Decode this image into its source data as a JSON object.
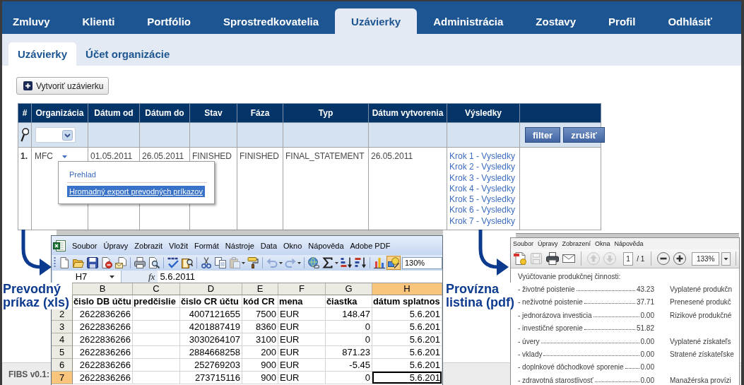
{
  "main_nav": {
    "tabs": [
      {
        "label": "Zmluvy",
        "selected": false
      },
      {
        "label": "Klienti",
        "selected": false
      },
      {
        "label": "Portfólio",
        "selected": false
      },
      {
        "label": "Sprostredkovatelia",
        "selected": false
      },
      {
        "label": "Uzávierky",
        "selected": true
      },
      {
        "label": "Administrácia",
        "selected": false
      },
      {
        "label": "Zostavy",
        "selected": false
      },
      {
        "label": "Profil",
        "selected": false
      },
      {
        "label": "Odhlásiť",
        "selected": false
      }
    ]
  },
  "sub_nav": {
    "tabs": [
      {
        "label": "Uzávierky",
        "selected": true
      },
      {
        "label": "Účet organizácie",
        "selected": false
      }
    ]
  },
  "create_button": {
    "label": "Vytvoriť uzávierku"
  },
  "table": {
    "columns": [
      "#",
      "Organizácia",
      "Dátum od",
      "Dátum do",
      "Stav",
      "Fáza",
      "Typ",
      "Dátum vytvorenia",
      "Výsledky"
    ],
    "filter_buttons": [
      "filter",
      "zrušiť"
    ],
    "rows": [
      {
        "number": "1.",
        "organization": "MFC",
        "date_from": "01.05.2011",
        "date_to": "26.05.2011",
        "state": "FINISHED",
        "phase": "FINISHED",
        "type": "FINAL_STATEMENT",
        "created": "26.05.2011",
        "results": [
          "Krok 1 - Vysledky",
          "Krok 2 - Vysledky",
          "Krok 3 - Vysledky",
          "Krok 4 - Vysledky",
          "Krok 5 - Vysledky",
          "Krok 6 - Vysledky",
          "Krok 7 - Vysledky"
        ]
      }
    ]
  },
  "row_menu": {
    "items": [
      {
        "label": "Prehlad",
        "selected": false
      },
      {
        "label": "Hromadný export prevodných príkazov",
        "selected": true
      }
    ]
  },
  "footer": {
    "text": "FIBS v0.1:"
  },
  "spreadsheet": {
    "menu": [
      "Soubor",
      "Úpravy",
      "Zobrazit",
      "Vložit",
      "Formát",
      "Nástroje",
      "Data",
      "Okno",
      "Nápověda",
      "Adobe PDF"
    ],
    "toolbar": [
      {
        "buttons": [
          {
            "kind": "new",
            "disabled": false,
            "on": false
          },
          {
            "kind": "open",
            "disabled": false,
            "on": false
          },
          {
            "kind": "save",
            "disabled": false,
            "on": false
          },
          {
            "kind": "permission",
            "disabled": false,
            "on": false
          },
          {
            "kind": "email",
            "disabled": false,
            "on": false
          }
        ]
      },
      {
        "buttons": [
          {
            "kind": "print",
            "disabled": false,
            "on": false
          },
          {
            "kind": "preview",
            "disabled": false,
            "on": false
          }
        ]
      },
      {
        "buttons": [
          {
            "kind": "spelling",
            "disabled": false,
            "on": false
          },
          {
            "kind": "research",
            "disabled": false,
            "on": false
          }
        ]
      },
      {
        "buttons": [
          {
            "kind": "cut",
            "disabled": false,
            "on": false
          },
          {
            "kind": "copy",
            "disabled": false,
            "on": false
          },
          {
            "kind": "paste",
            "disabled": true,
            "on": false,
            "dropdown": true
          },
          {
            "kind": "painter",
            "disabled": false,
            "on": false
          }
        ]
      },
      {
        "buttons": [
          {
            "kind": "undo",
            "disabled": true,
            "on": false,
            "dropdown": true
          },
          {
            "kind": "redo",
            "disabled": true,
            "on": false,
            "dropdown": true
          }
        ]
      },
      {
        "buttons": [
          {
            "kind": "hyperlink",
            "disabled": false,
            "on": false
          },
          {
            "kind": "autosum",
            "disabled": false,
            "on": false,
            "dropdown": true
          },
          {
            "kind": "sortasc",
            "disabled": false,
            "on": false
          },
          {
            "kind": "sortdesc",
            "disabled": false,
            "on": false
          }
        ]
      },
      {
        "buttons": [
          {
            "kind": "chart",
            "disabled": false,
            "on": false
          },
          {
            "kind": "drawing",
            "disabled": false,
            "on": true
          }
        ],
        "zoom": "130%"
      }
    ],
    "name_box": "H7",
    "function_button": "fx",
    "formula": "5.6.2011",
    "columns": [
      {
        "letter": "B",
        "selected": false,
        "kind": "number"
      },
      {
        "letter": "C",
        "selected": false,
        "kind": "text"
      },
      {
        "letter": "D",
        "selected": false,
        "kind": "number"
      },
      {
        "letter": "E",
        "selected": false,
        "kind": "number"
      },
      {
        "letter": "F",
        "selected": false,
        "kind": "text"
      },
      {
        "letter": "G",
        "selected": false,
        "kind": "number"
      },
      {
        "letter": "H",
        "selected": true,
        "kind": "number"
      }
    ],
    "rows": [
      {
        "kind": "header",
        "selected": false,
        "cells": {
          "B": "čislo DB účtu",
          "C": "predčislie",
          "D": "čislo CR účtu",
          "E": "kód CR",
          "F": "mena",
          "G": "čiastka",
          "H": "dátum splatnos"
        }
      },
      {
        "number": "2",
        "kind": "data",
        "selected": false,
        "cells": {
          "B": "2622836266",
          "D": "4007121655",
          "E": "7500",
          "F": "EUR",
          "G": "148.47",
          "H": "5.6.201"
        }
      },
      {
        "number": "3",
        "kind": "data",
        "selected": false,
        "cells": {
          "B": "2622836266",
          "D": "4201887419",
          "E": "8360",
          "F": "EUR",
          "G": "0",
          "H": "5.6.201"
        }
      },
      {
        "number": "4",
        "kind": "data",
        "selected": false,
        "cells": {
          "B": "2622836266",
          "D": "3030264107",
          "E": "3100",
          "F": "EUR",
          "G": "0",
          "H": "5.6.201"
        }
      },
      {
        "number": "5",
        "kind": "data",
        "selected": false,
        "cells": {
          "B": "2622836266",
          "D": "2884668258",
          "E": "200",
          "F": "EUR",
          "G": "871.23",
          "H": "5.6.201"
        }
      },
      {
        "number": "6",
        "kind": "data",
        "selected": false,
        "cells": {
          "B": "2622836266",
          "D": "252769203",
          "E": "900",
          "F": "EUR",
          "G": "-5.45",
          "H": "5.6.201"
        }
      },
      {
        "number": "7",
        "kind": "data",
        "selected": true,
        "cells": {
          "B": "2622836266",
          "D": "273715116",
          "E": "900",
          "F": "EUR",
          "G": "0",
          "H": "5.6.201"
        }
      }
    ]
  },
  "pdf_viewer": {
    "menu": [
      "Soubor",
      "Úpravy",
      "Zobrazení",
      "Okna",
      "Nápověda"
    ],
    "toolbar": [
      {
        "buttons": [
          {
            "kind": "create",
            "disabled": false
          },
          {
            "kind": "save",
            "disabled": true
          },
          {
            "kind": "print",
            "disabled": false
          },
          {
            "kind": "email",
            "disabled": false
          }
        ]
      },
      {
        "buttons": [
          {
            "kind": "previous",
            "disabled": true
          },
          {
            "kind": "next",
            "disabled": true
          }
        ],
        "page": "1",
        "page_count": "/ 1"
      },
      {
        "buttons": [
          {
            "kind": "zoomout",
            "disabled": false
          },
          {
            "kind": "zoomin",
            "disabled": false
          }
        ],
        "zoom": "133%"
      }
    ],
    "heading": "Vyúčtovanie produkčnej činnosti:",
    "items": [
      {
        "label": "- životné poistenie",
        "value": "43.23"
      },
      {
        "label": "- neživotné poistenie",
        "value": "37.71"
      },
      {
        "label": "- jednorázova investicia",
        "value": "0.00"
      },
      {
        "label": "- investičné sporenie",
        "value": "51.82"
      },
      {
        "label": "- úvery",
        "value": "0.00"
      },
      {
        "label": "- vklady",
        "value": "0.00"
      },
      {
        "label": "- doplnkové dôchodkové sporenie",
        "value": "0.00"
      },
      {
        "label": "- zdravotná starostlivosť",
        "value": "0.00"
      }
    ],
    "side_groups": [
      [
        "Vyplatené produkčn",
        "Prenesené produkč",
        "Rizikové produkčné"
      ],
      [
        "Vyplatené získateľs",
        "Stratené získateľske"
      ],
      [
        "Manažérska provízi"
      ]
    ]
  },
  "callouts": [
    {
      "label": "Prevodný príkaz (xls)"
    },
    {
      "label": "Provízna listina (pdf)"
    }
  ]
}
